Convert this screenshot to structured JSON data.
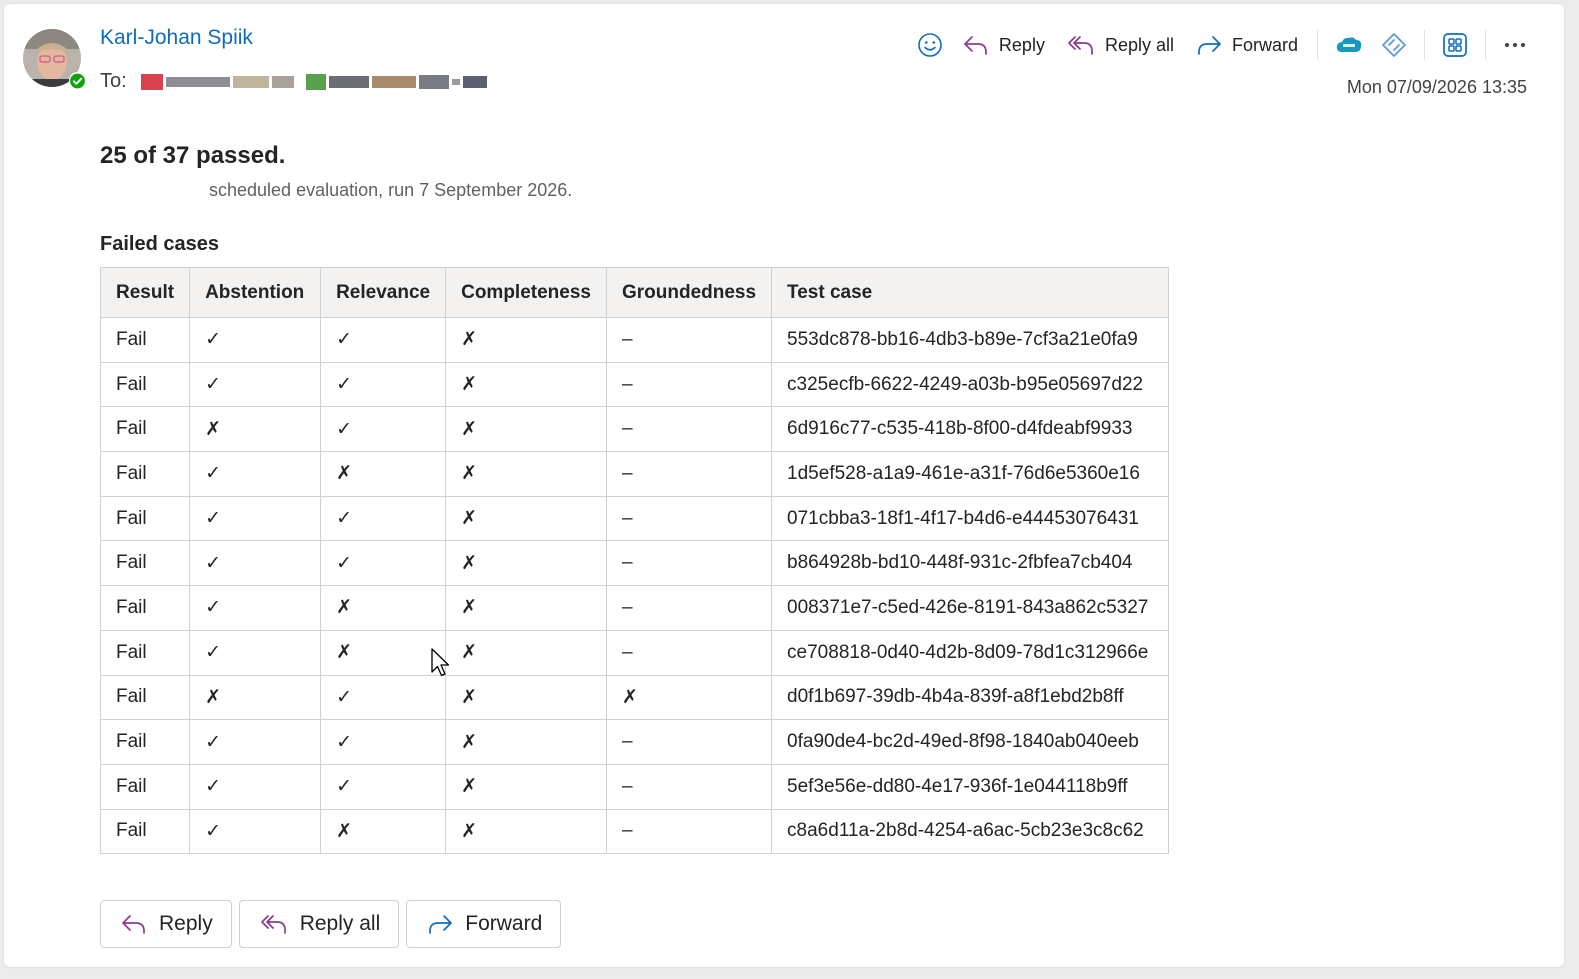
{
  "message": {
    "sender_name": "Karl-Johan Spiik",
    "to_label": "To:",
    "date": "Mon 07/09/2026 13:35"
  },
  "toolbar": {
    "emoji_icon": "smiley-icon",
    "reply_label": "Reply",
    "reply_all_label": "Reply all",
    "forward_label": "Forward"
  },
  "body": {
    "summary": "25 of 37 passed.",
    "subline": "scheduled evaluation, run 7 September 2026.",
    "section_title": "Failed cases",
    "table": {
      "headers": [
        "Result",
        "Abstention",
        "Relevance",
        "Completeness",
        "Groundedness",
        "Test case"
      ],
      "rows": [
        [
          "Fail",
          "✓",
          "✓",
          "✗",
          "–",
          "553dc878-bb16-4db3-b89e-7cf3a21e0fa9"
        ],
        [
          "Fail",
          "✓",
          "✓",
          "✗",
          "–",
          "c325ecfb-6622-4249-a03b-b95e05697d22"
        ],
        [
          "Fail",
          "✗",
          "✓",
          "✗",
          "–",
          "6d916c77-c535-418b-8f00-d4fdeabf9933"
        ],
        [
          "Fail",
          "✓",
          "✗",
          "✗",
          "–",
          "1d5ef528-a1a9-461e-a31f-76d6e5360e16"
        ],
        [
          "Fail",
          "✓",
          "✓",
          "✗",
          "–",
          "071cbba3-18f1-4f17-b4d6-e44453076431"
        ],
        [
          "Fail",
          "✓",
          "✓",
          "✗",
          "–",
          "b864928b-bd10-448f-931c-2fbfea7cb404"
        ],
        [
          "Fail",
          "✓",
          "✗",
          "✗",
          "–",
          "008371e7-c5ed-426e-8191-843a862c5327"
        ],
        [
          "Fail",
          "✓",
          "✗",
          "✗",
          "–",
          "ce708818-0d40-4d2b-8d09-78d1c312966e"
        ],
        [
          "Fail",
          "✗",
          "✓",
          "✗",
          "✗",
          "d0f1b697-39db-4b4a-839f-a8f1ebd2b8ff"
        ],
        [
          "Fail",
          "✓",
          "✓",
          "✗",
          "–",
          "0fa90de4-bc2d-49ed-8f98-1840ab040eeb"
        ],
        [
          "Fail",
          "✓",
          "✓",
          "✗",
          "–",
          "5ef3e56e-dd80-4e17-936f-1e044118b9ff"
        ],
        [
          "Fail",
          "✓",
          "✗",
          "✗",
          "–",
          "c8a6d11a-2b8d-4254-a6ac-5cb23e3c8c62"
        ]
      ]
    }
  },
  "bottom_actions": {
    "reply_label": "Reply",
    "reply_all_label": "Reply all",
    "forward_label": "Forward"
  },
  "colors": {
    "accent": "#0f6cbd",
    "reply_icon": "#8a3b8f",
    "forward_icon": "#0f6cbd",
    "presence": "#13a10e"
  }
}
